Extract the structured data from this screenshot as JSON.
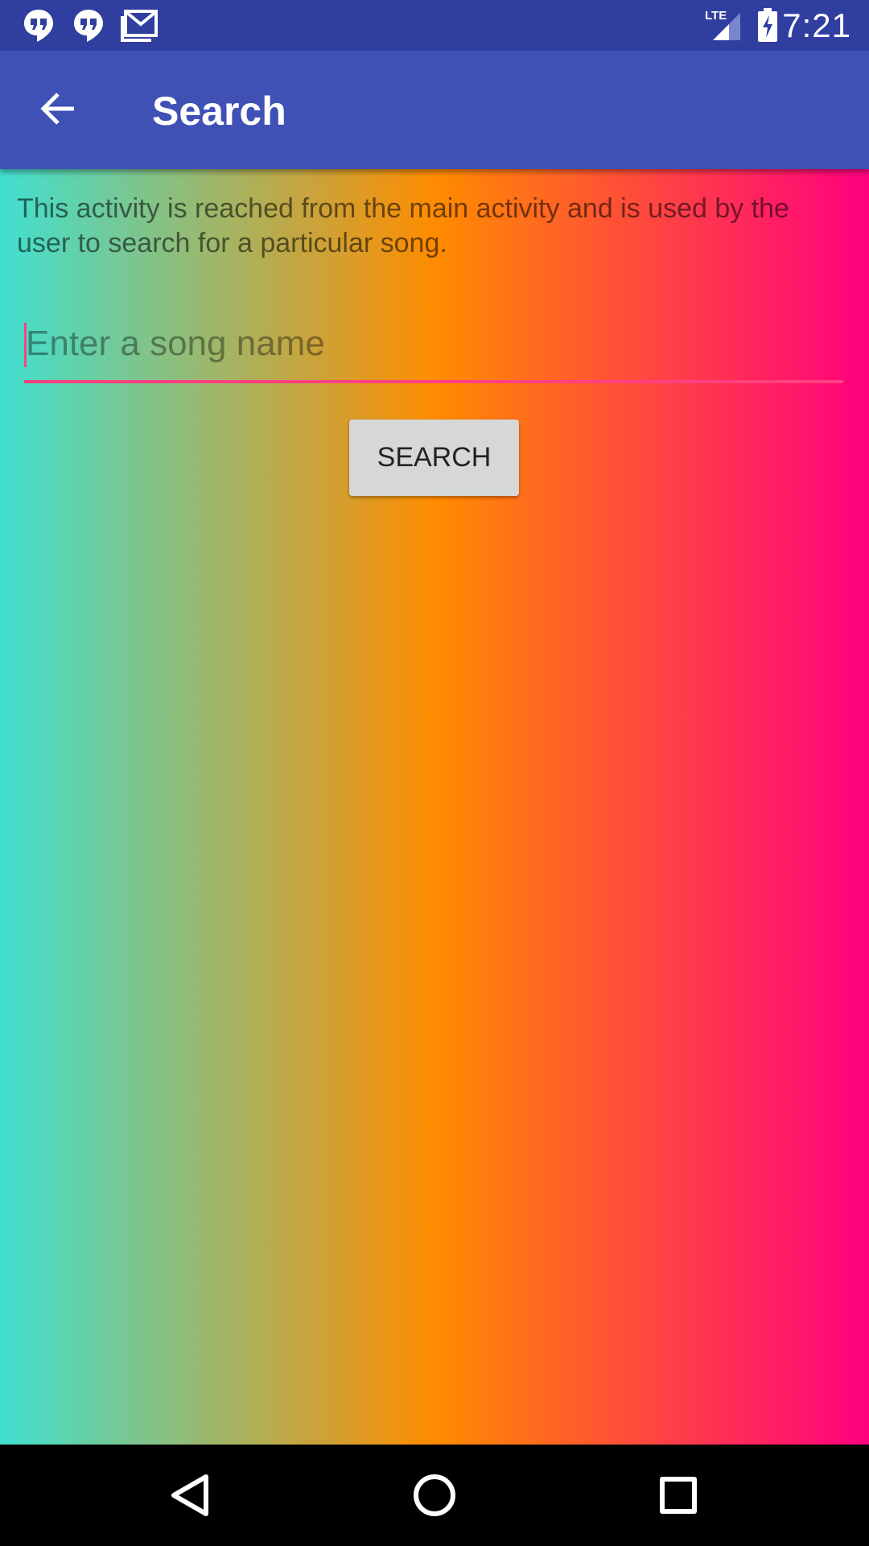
{
  "status_bar": {
    "time": "7:21",
    "network": "LTE",
    "left_icons": [
      "hangouts-icon",
      "hangouts-icon",
      "gmail-icon"
    ],
    "right_icons": [
      "lte-signal-icon",
      "battery-charging-icon"
    ]
  },
  "app_bar": {
    "title": "Search",
    "back_icon": "arrow-back-icon"
  },
  "content": {
    "description": "This activity is reached from the main activity and is used by the user to search for a particular song.",
    "search_input": {
      "placeholder": "Enter a song name",
      "value": ""
    },
    "search_button_label": "SEARCH"
  },
  "nav_bar": {
    "buttons": [
      "back-triangle-icon",
      "home-circle-icon",
      "recents-square-icon"
    ]
  },
  "colors": {
    "status_bar": "#303F9F",
    "app_bar": "#3F51B5",
    "accent": "#FF4081",
    "gradient": [
      "#40E0D0",
      "#FF8C00",
      "#FF0080"
    ]
  }
}
